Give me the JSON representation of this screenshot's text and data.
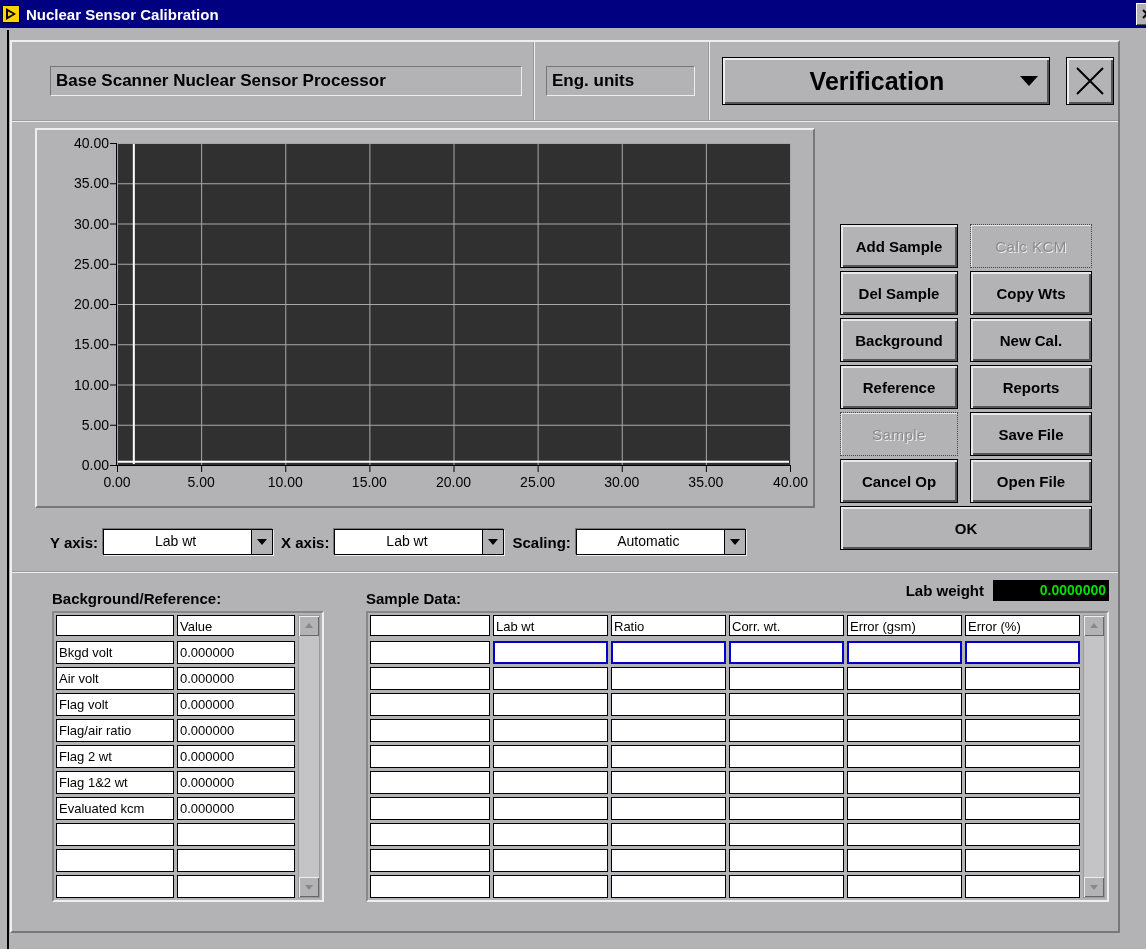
{
  "window": {
    "title": "Nuclear Sensor Calibration"
  },
  "header": {
    "processor": "Base Scanner Nuclear Sensor Processor",
    "units": "Eng. units",
    "mode": "Verification"
  },
  "graph": {
    "chart_data": {
      "type": "line",
      "grid": true,
      "ref_lines": [
        {
          "axis": "x",
          "value": 1
        },
        {
          "axis": "y",
          "value": 0.4
        }
      ],
      "xlim": [
        0,
        40
      ],
      "ylim": [
        0,
        40
      ],
      "xticks": [
        {
          "value": 0,
          "label": "0.00"
        },
        {
          "value": 5,
          "label": "5.00"
        },
        {
          "value": 10,
          "label": "10.00"
        },
        {
          "value": 15,
          "label": "15.00"
        },
        {
          "value": 20,
          "label": "20.00"
        },
        {
          "value": 25,
          "label": "25.00"
        },
        {
          "value": 30,
          "label": "30.00"
        },
        {
          "value": 35,
          "label": "35.00"
        },
        {
          "value": 40,
          "label": "40.00"
        }
      ],
      "yticks": [
        {
          "value": 0,
          "label": "0.00"
        },
        {
          "value": 5,
          "label": "5.00"
        },
        {
          "value": 10,
          "label": "10.00"
        },
        {
          "value": 15,
          "label": "15.00"
        },
        {
          "value": 20,
          "label": "20.00"
        },
        {
          "value": 25,
          "label": "25.00"
        },
        {
          "value": 30,
          "label": "30.00"
        },
        {
          "value": 35,
          "label": "35.00"
        },
        {
          "value": 40,
          "label": "40.00"
        }
      ]
    }
  },
  "axis_controls": [
    {
      "label": "Y axis:",
      "value": "Lab wt"
    },
    {
      "label": "X axis:",
      "value": "Lab wt"
    },
    {
      "label": "Scaling:",
      "value": "Automatic"
    }
  ],
  "buttons": [
    {
      "label": "Add Sample",
      "disabled": false
    },
    {
      "label": "Calc KCM",
      "disabled": true
    },
    {
      "label": "Del Sample",
      "disabled": false
    },
    {
      "label": "Copy Wts",
      "disabled": false
    },
    {
      "label": "Background",
      "disabled": false
    },
    {
      "label": "New Cal.",
      "disabled": false
    },
    {
      "label": "Reference",
      "disabled": false
    },
    {
      "label": "Reports",
      "disabled": false
    },
    {
      "label": "Sample",
      "disabled": true
    },
    {
      "label": "Save File",
      "disabled": false
    },
    {
      "label": "Cancel Op",
      "disabled": false
    },
    {
      "label": "Open File",
      "disabled": false
    }
  ],
  "ok_button": {
    "label": "OK"
  },
  "background_reference": {
    "title": "Background/Reference:",
    "columns": [
      "Value"
    ],
    "rows": [
      {
        "label": "Bkgd volt",
        "value": "0.000000"
      },
      {
        "label": "Air volt",
        "value": "0.000000"
      },
      {
        "label": "Flag volt",
        "value": "0.000000"
      },
      {
        "label": "Flag/air ratio",
        "value": "0.000000"
      },
      {
        "label": "Flag 2 wt",
        "value": "0.000000"
      },
      {
        "label": "Flag 1&2 wt",
        "value": "0.000000"
      },
      {
        "label": "Evaluated kcm",
        "value": "0.000000"
      }
    ]
  },
  "lab_weight": {
    "label": "Lab weight",
    "value": "0.0000000"
  },
  "sample_data": {
    "title": "Sample Data:",
    "columns": [
      "Lab wt",
      "Ratio",
      "Corr. wt.",
      "Error (gsm)",
      "Error (%)"
    ],
    "rows": [
      {
        "selected": true
      },
      {
        "selected": false
      },
      {
        "selected": false
      },
      {
        "selected": false
      },
      {
        "selected": false
      },
      {
        "selected": false
      },
      {
        "selected": false
      },
      {
        "selected": false
      },
      {
        "selected": false
      },
      {
        "selected": false
      }
    ]
  }
}
